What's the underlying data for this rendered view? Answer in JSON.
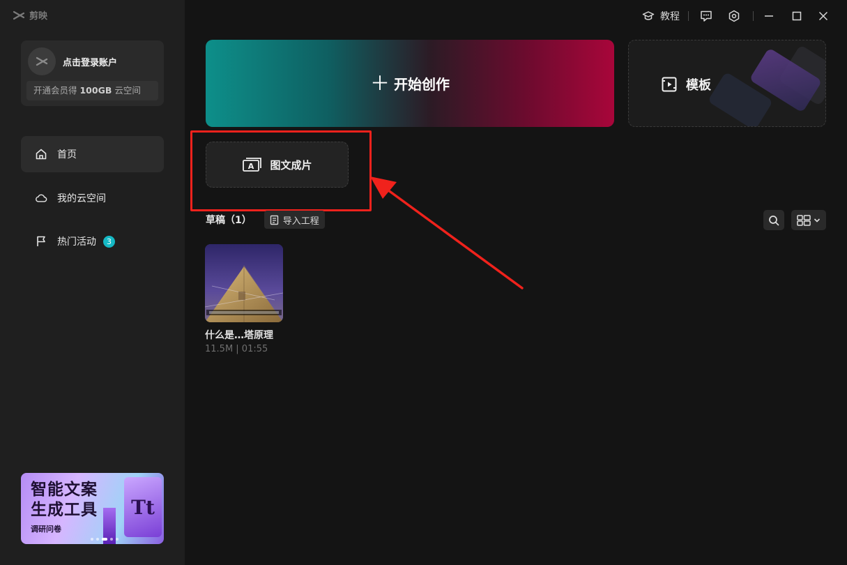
{
  "app": {
    "name": "剪映"
  },
  "account": {
    "login_label": "点击登录账户",
    "vip_prefix": "开通会员得 ",
    "vip_capacity": "100GB",
    "vip_suffix": " 云空间"
  },
  "sidebar": {
    "items": [
      {
        "label": "首页",
        "icon": "home-icon",
        "active": true
      },
      {
        "label": "我的云空间",
        "icon": "cloud-icon"
      },
      {
        "label": "热门活动",
        "icon": "flag-icon",
        "badge": "3"
      }
    ]
  },
  "banner": {
    "title_line1": "智能文案",
    "title_line2": "生成工具",
    "subtitle": "调研问卷",
    "glyph": "Tt"
  },
  "topbar": {
    "tutorial_label": "教程"
  },
  "main": {
    "create_label": "开始创作",
    "template_label": "模板",
    "tuwen_label": "图文成片",
    "drafts_label": "草稿（1）",
    "import_label": "导入工程",
    "draft": {
      "name": "什么是…塔原理",
      "meta": "11.5M | 01:55"
    }
  },
  "colors": {
    "accent_teal": "#0d8f8a",
    "accent_crimson": "#a8063a",
    "highlight_red": "#f0221c",
    "badge": "#15b8c4"
  }
}
